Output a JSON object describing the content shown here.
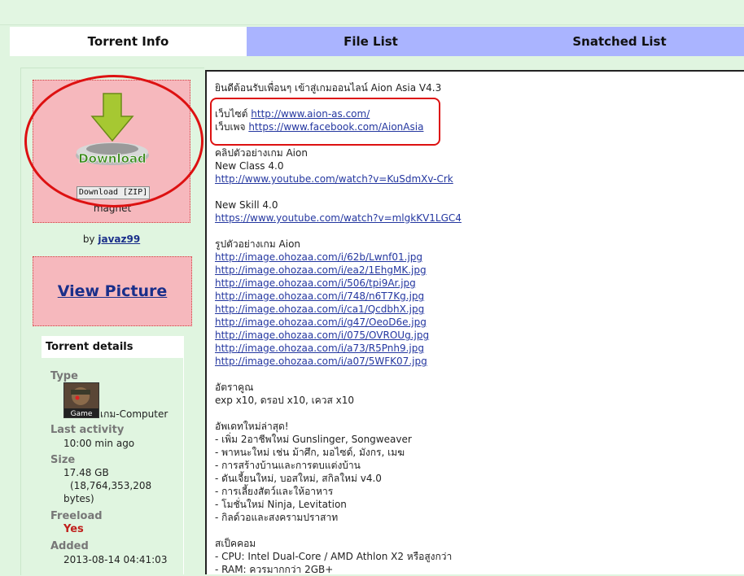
{
  "tabs": [
    {
      "label": "Torrent Info"
    },
    {
      "label": "File List"
    },
    {
      "label": "Snatched List"
    }
  ],
  "download": {
    "icon_text": "Download",
    "zip_label": "Download [ZIP]",
    "magnet_label": "magnet"
  },
  "byline": {
    "prefix": "by",
    "user": "javaz99"
  },
  "view_picture": "View Picture",
  "details": {
    "header": "Torrent details",
    "type_label": "Type",
    "type_badge": "Game",
    "type_value": "เกม-Computer",
    "last_activity_label": "Last activity",
    "last_activity_value": "10:00 min ago",
    "size_label": "Size",
    "size_value1": "17.48 GB",
    "size_value2": "(18,764,353,208",
    "size_value3": "bytes)",
    "freeload_label": "Freeload",
    "freeload_value": "Yes",
    "added_label": "Added",
    "added_value": "2013-08-14 04:41:03"
  },
  "description": {
    "intro": "ยินดีต้อนรับเพื่อนๆ เข้าสู่เกมออนไลน์ Aion Asia V4.3",
    "website_label": "เว็บไซต์",
    "website_url": "http://www.aion-as.com/",
    "page_label": "เว็บเพจ",
    "page_url": "https://www.facebook.com/AionAsia",
    "clip_heading": "คลิปตัวอย่างเกม Aion",
    "new_class": "New Class 4.0",
    "new_class_url": "http://www.youtube.com/watch?v=KuSdmXv-Crk",
    "new_skill": "New Skill 4.0",
    "new_skill_url": "https://www.youtube.com/watch?v=mlgkKV1LGC4",
    "pic_heading": "รูปตัวอย่างเกม Aion",
    "images": [
      "http://image.ohozaa.com/i/62b/Lwnf01.jpg",
      "http://image.ohozaa.com/i/ea2/1EhgMK.jpg",
      "http://image.ohozaa.com/i/506/tpi9Ar.jpg",
      "http://image.ohozaa.com/i/748/n6T7Kg.jpg",
      "http://image.ohozaa.com/i/ca1/QcdbhX.jpg",
      "http://image.ohozaa.com/i/g47/OeoD6e.jpg",
      "http://image.ohozaa.com/i/075/OVROUg.jpg",
      "http://image.ohozaa.com/i/a73/R5Pnh9.jpg",
      "http://image.ohozaa.com/i/a07/5WFK07.jpg"
    ],
    "rate_heading": "อัตราคูณ",
    "rate_value": "exp x10, ดรอป x10, เควส x10",
    "update_heading": "อัพเดทใหม่ล่าสุด!",
    "updates": [
      "- เพิ่ม 2อาชีพใหม่ Gunslinger, Songweaver",
      "- พาหนะใหม่ เช่น ม้าศึก, มอไซด์, มังกร, เมฆ",
      "- การสร้างบ้านและการตบแต่งบ้าน",
      "- ดันเจี้ยนใหม่, บอสใหม่, สกิลใหม่ v4.0",
      "- การเลี้ยงสัตว์และให้อาหาร",
      "- โมชั่นใหม่ Ninja, Levitation",
      "- กิลด์วอและสงครามปราสาท"
    ],
    "spec_heading": "สเป็คคอม",
    "specs": [
      "- CPU: Intel Dual-Core / AMD Athlon X2 หรือสูงกว่า",
      "- RAM: ควรมากกว่า 2GB+"
    ]
  },
  "colors": {
    "page_bg": "#e0f5e0",
    "tab_inactive": "#aab4ff",
    "pink_box": "#f6b8bd",
    "link": "#2437a0",
    "highlight": "#dd1111",
    "yes": "#c0201c"
  }
}
